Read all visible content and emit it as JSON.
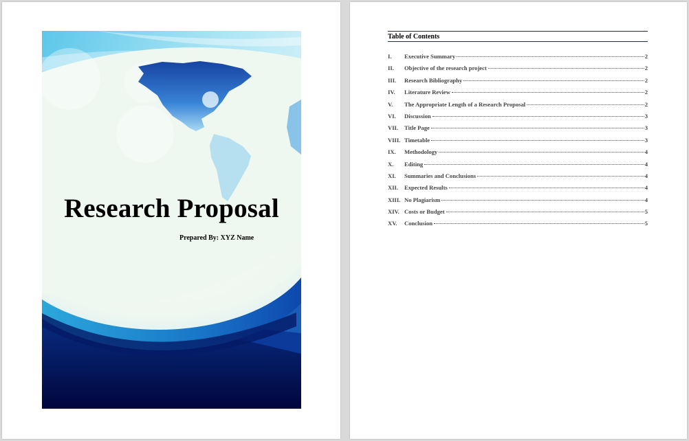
{
  "cover": {
    "title": "Research Proposal",
    "prepared_by": "Prepared By: XYZ Name"
  },
  "toc": {
    "heading": "Table of Contents",
    "entries": [
      {
        "num": "I.",
        "text": "Executive Summary",
        "page": "2"
      },
      {
        "num": "II.",
        "text": "Objective of the research project",
        "page": "2"
      },
      {
        "num": "III.",
        "text": "Research Bibliography",
        "page": "2"
      },
      {
        "num": "IV.",
        "text": "Literature Review",
        "page": "2"
      },
      {
        "num": "V.",
        "text": "The Appropriate Length of a Research Proposal",
        "page": "2"
      },
      {
        "num": "VI.",
        "text": "Discussion",
        "page": "3"
      },
      {
        "num": "VII.",
        "text": "Title Page",
        "page": "3"
      },
      {
        "num": "VIII.",
        "text": "Timetable",
        "page": "3"
      },
      {
        "num": "IX.",
        "text": "Methodology",
        "page": "4"
      },
      {
        "num": "X.",
        "text": "Editing",
        "page": "4"
      },
      {
        "num": "XI.",
        "text": "Summaries and Conclusions",
        "page": "4"
      },
      {
        "num": "XII.",
        "text": "Expected Results",
        "page": "4"
      },
      {
        "num": "XIII.",
        "text": "No Plagiarism",
        "page": "4"
      },
      {
        "num": "XIV.",
        "text": "Costs or Budget",
        "page": "5"
      },
      {
        "num": "XV.",
        "text": "Conclusion",
        "page": "5"
      }
    ]
  },
  "colors": {
    "navy": "#020a45",
    "deep_blue": "#0a2f8f",
    "sky": "#7fd3ee",
    "cream": "#f2f8f2"
  }
}
